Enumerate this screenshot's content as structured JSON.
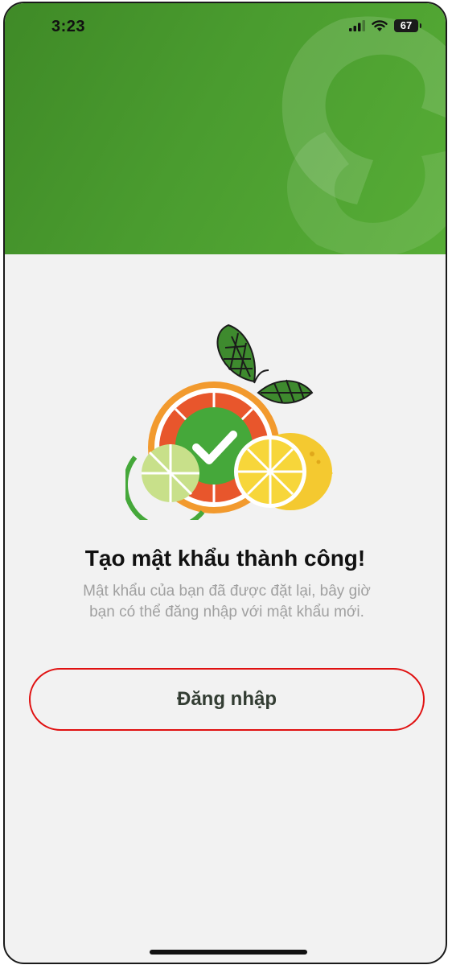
{
  "status_bar": {
    "time": "3:23",
    "battery_level": "67"
  },
  "success": {
    "title": "Tạo mật khẩu thành công!",
    "message": "Mật khẩu của bạn đã được đặt lại, bây giờ bạn có thể đăng nhập với mật khẩu mới."
  },
  "actions": {
    "login_label": "Đăng nhập"
  },
  "colors": {
    "header_green": "#4a9c2f",
    "button_border": "#e01010",
    "check_green": "#45a83a",
    "orange": "#f29a2e",
    "lemon": "#f7d63a"
  },
  "icons": {
    "signal": "signal-icon",
    "wifi": "wifi-icon",
    "battery": "battery-icon",
    "checkmark": "checkmark-icon"
  }
}
